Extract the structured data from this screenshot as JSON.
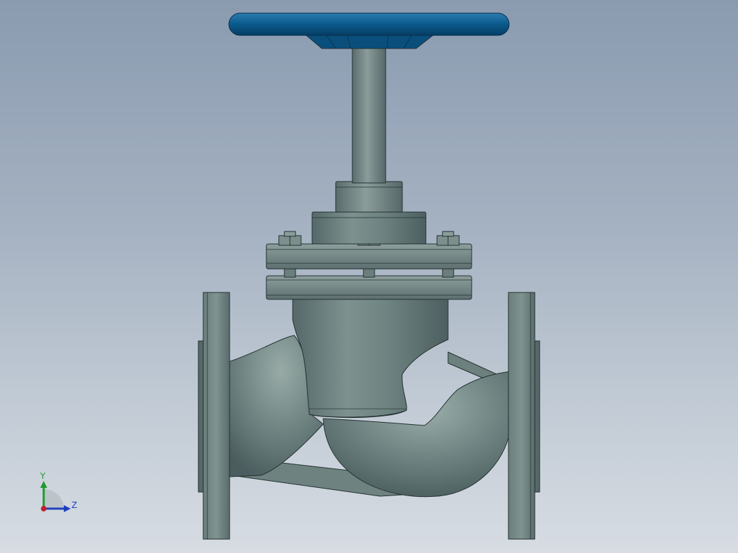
{
  "viewport": {
    "background_top": "#8a9bb0",
    "background_bottom": "#d7dce3"
  },
  "model": {
    "handwheel_color": "#0b5a8c",
    "body_color": "#6f8580"
  },
  "triad": {
    "y_label": "Y",
    "z_label": "Z",
    "y_color": "#1e9a2e",
    "z_color": "#1f3fbf",
    "origin_color": "#c0202a"
  }
}
